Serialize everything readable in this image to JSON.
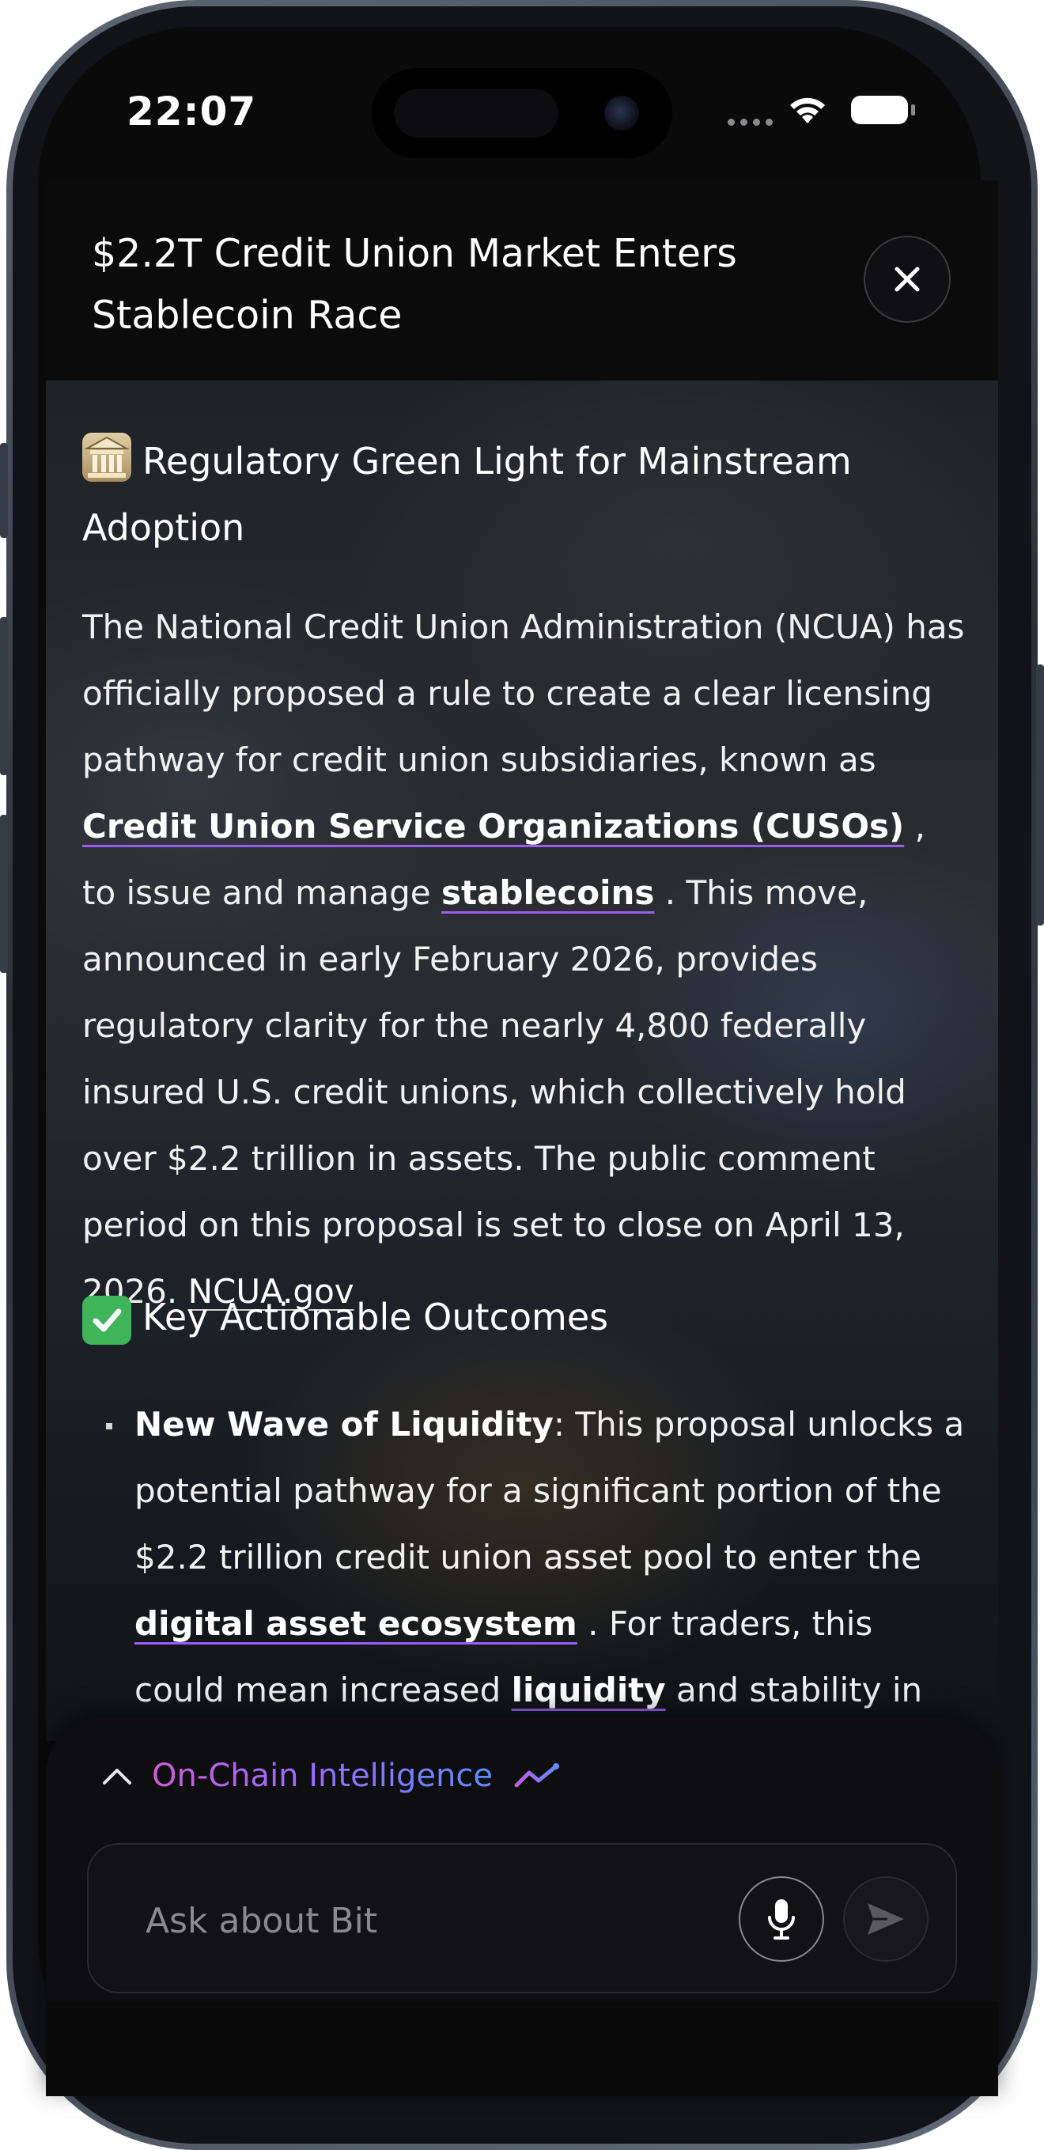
{
  "status_bar": {
    "time": "22:07"
  },
  "header": {
    "title": "$2.2T Credit Union Market Enters Stablecoin Race"
  },
  "article": {
    "section1": {
      "emoji": "bank-building-emoji",
      "heading": "Regulatory Green Light for Mainstream Adoption"
    },
    "para1": {
      "t1": "The National Credit Union Administration (NCUA) has officially proposed a rule to create a clear licensing pathway for credit union subsidiaries, known as ",
      "term1": "Credit Union Service Organizations (CUSOs)",
      "t2": " , to issue and manage ",
      "term2": "stablecoins",
      "t3": " . This move, announced in early February 2026, provides regulatory clarity for the nearly 4,800 federally insured U.S. credit unions, which collectively hold over $2.2 trillion in assets. The public comment period on this proposal is set to close on April 13, 2026. ",
      "source": "NCUA.gov"
    },
    "section2": {
      "emoji": "check-mark-emoji",
      "heading": "Key Actionable Outcomes"
    },
    "bullet1": {
      "bold": "New Wave of Liquidity",
      "t1": ": This proposal unlocks a potential pathway for a significant portion of the $2.2 trillion credit union asset pool to enter the ",
      "term1": "digital asset ecosystem",
      "t2": " . For traders, this could mean increased ",
      "term2": "liquidity",
      "t3": "  and stability in the"
    }
  },
  "composer": {
    "intel_label": "On-Chain Intelligence",
    "input_placeholder": "Ask about Bit",
    "icons": {
      "collapse": "chevron-up-icon",
      "trend": "trend-line-icon",
      "mic": "microphone-icon",
      "send": "send-icon"
    }
  },
  "colors": {
    "background": "#0a0a0b",
    "term_underline": "#9b5cf6",
    "gradient_start": "#d05bd8",
    "gradient_end": "#5c8cff"
  }
}
